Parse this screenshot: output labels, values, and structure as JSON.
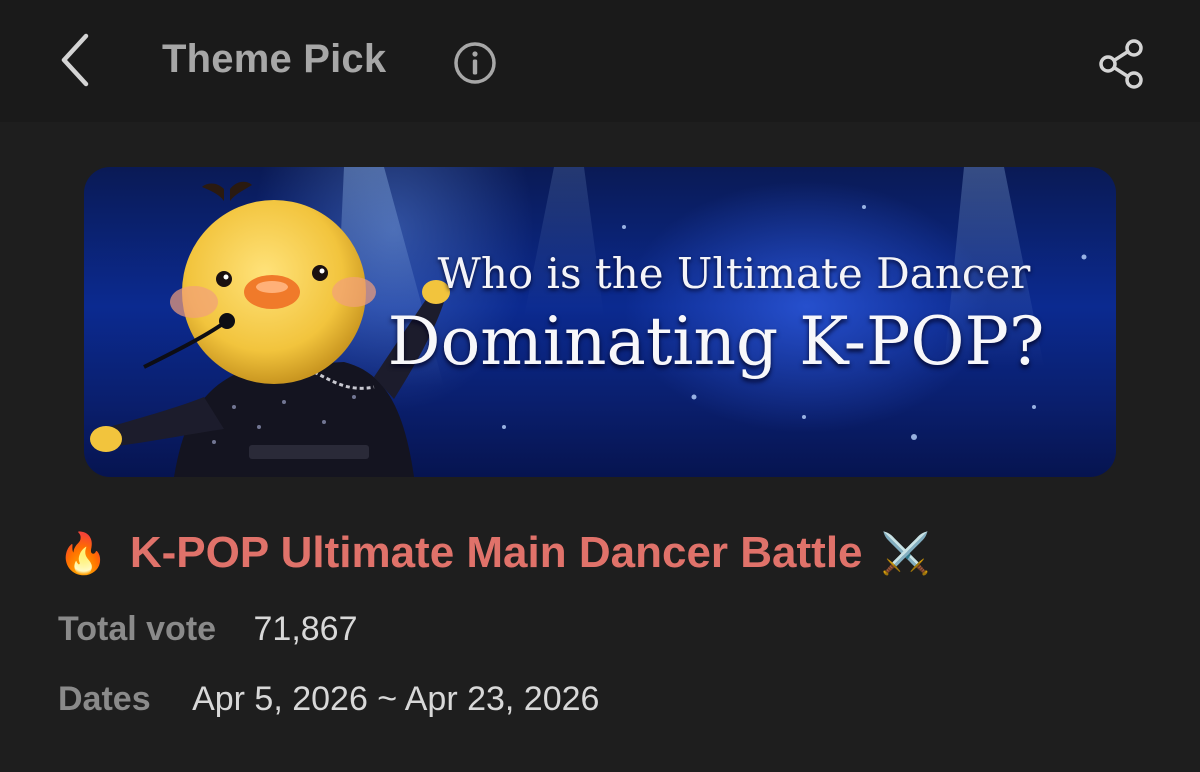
{
  "header": {
    "title": "Theme Pick",
    "back_icon": "chevron-left-icon",
    "info_icon": "info-icon",
    "share_icon": "share-icon"
  },
  "banner": {
    "line1": "Who is the Ultimate Dancer",
    "line2": "Dominating K-POP?"
  },
  "theme": {
    "prefix_emoji": "🔥",
    "title": "K-POP Ultimate Main Dancer Battle",
    "suffix_emoji": "⚔️"
  },
  "stats": {
    "total_vote_label": "Total vote",
    "total_vote_value": "71,867",
    "dates_label": "Dates",
    "dates_value": "Apr 5, 2026 ~ Apr 23, 2026"
  },
  "colors": {
    "background": "#1e1e1e",
    "header_bg": "#1a1a1a",
    "title_accent": "#e0726a",
    "muted_text": "#8a8a8a"
  }
}
